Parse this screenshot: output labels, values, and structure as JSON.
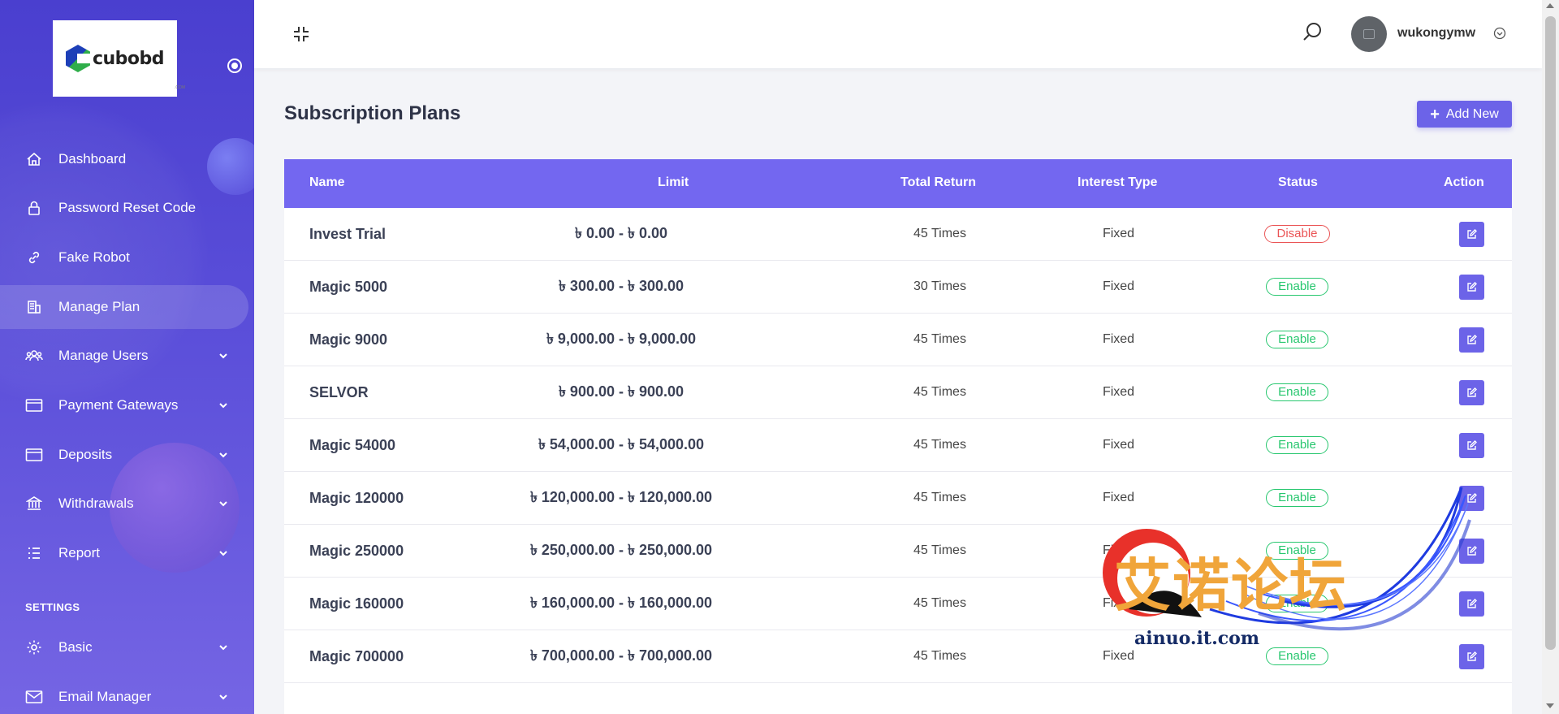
{
  "brand": {
    "logo_text": "cubobd",
    "logo_sub": ".COM"
  },
  "sidebar": {
    "items": [
      {
        "label": "Dashboard",
        "icon": "home-icon",
        "active": false,
        "has_children": false
      },
      {
        "label": "Password Reset Code",
        "icon": "lock-icon",
        "active": false,
        "has_children": false
      },
      {
        "label": "Fake Robot",
        "icon": "link-icon",
        "active": false,
        "has_children": false
      },
      {
        "label": "Manage Plan",
        "icon": "building-icon",
        "active": true,
        "has_children": false
      },
      {
        "label": "Manage Users",
        "icon": "users-icon",
        "active": false,
        "has_children": true
      },
      {
        "label": "Payment Gateways",
        "icon": "credit-card-icon",
        "active": false,
        "has_children": true
      },
      {
        "label": "Deposits",
        "icon": "wallet-icon",
        "active": false,
        "has_children": true
      },
      {
        "label": "Withdrawals",
        "icon": "bank-icon",
        "active": false,
        "has_children": true
      },
      {
        "label": "Report",
        "icon": "list-icon",
        "active": false,
        "has_children": true
      }
    ],
    "settings_heading": "SETTINGS",
    "settings_items": [
      {
        "label": "Basic",
        "icon": "gear-icon",
        "has_children": true
      },
      {
        "label": "Email Manager",
        "icon": "envelope-icon",
        "has_children": true
      }
    ]
  },
  "topbar": {
    "username": "wukongymw"
  },
  "main": {
    "title": "Subscription Plans",
    "add_button": "Add New",
    "table": {
      "headers": [
        "Name",
        "Limit",
        "Total Return",
        "Interest Type",
        "Status",
        "Action"
      ],
      "rows": [
        {
          "name": "Invest Trial",
          "limit": "৳ 0.00 - ৳ 0.00",
          "total_return": "45 Times",
          "interest_type": "Fixed",
          "status": "Disable"
        },
        {
          "name": "Magic 5000",
          "limit": "৳ 300.00 - ৳ 300.00",
          "total_return": "30 Times",
          "interest_type": "Fixed",
          "status": "Enable"
        },
        {
          "name": "Magic 9000",
          "limit": "৳ 9,000.00 - ৳ 9,000.00",
          "total_return": "45 Times",
          "interest_type": "Fixed",
          "status": "Enable"
        },
        {
          "name": "SELVOR",
          "limit": "৳ 900.00 - ৳ 900.00",
          "total_return": "45 Times",
          "interest_type": "Fixed",
          "status": "Enable"
        },
        {
          "name": "Magic 54000",
          "limit": "৳ 54,000.00 - ৳ 54,000.00",
          "total_return": "45 Times",
          "interest_type": "Fixed",
          "status": "Enable"
        },
        {
          "name": "Magic 120000",
          "limit": "৳ 120,000.00 - ৳ 120,000.00",
          "total_return": "45 Times",
          "interest_type": "Fixed",
          "status": "Enable"
        },
        {
          "name": "Magic 250000",
          "limit": "৳ 250,000.00 - ৳ 250,000.00",
          "total_return": "45 Times",
          "interest_type": "Fixed",
          "status": "Enable"
        },
        {
          "name": "Magic 160000",
          "limit": "৳ 160,000.00 - ৳ 160,000.00",
          "total_return": "45 Times",
          "interest_type": "Fixed",
          "status": "Enable"
        },
        {
          "name": "Magic 700000",
          "limit": "৳ 700,000.00 - ৳ 700,000.00",
          "total_return": "45 Times",
          "interest_type": "Fixed",
          "status": "Enable"
        }
      ]
    }
  },
  "watermark": {
    "text": "艾诺论坛",
    "url": "ainuo.it.com"
  },
  "colors": {
    "sidebar": "#4a3fcf",
    "accent": "#7367f0",
    "button": "#6c63e8",
    "enable": "#28c76f",
    "disable": "#ea5455"
  }
}
